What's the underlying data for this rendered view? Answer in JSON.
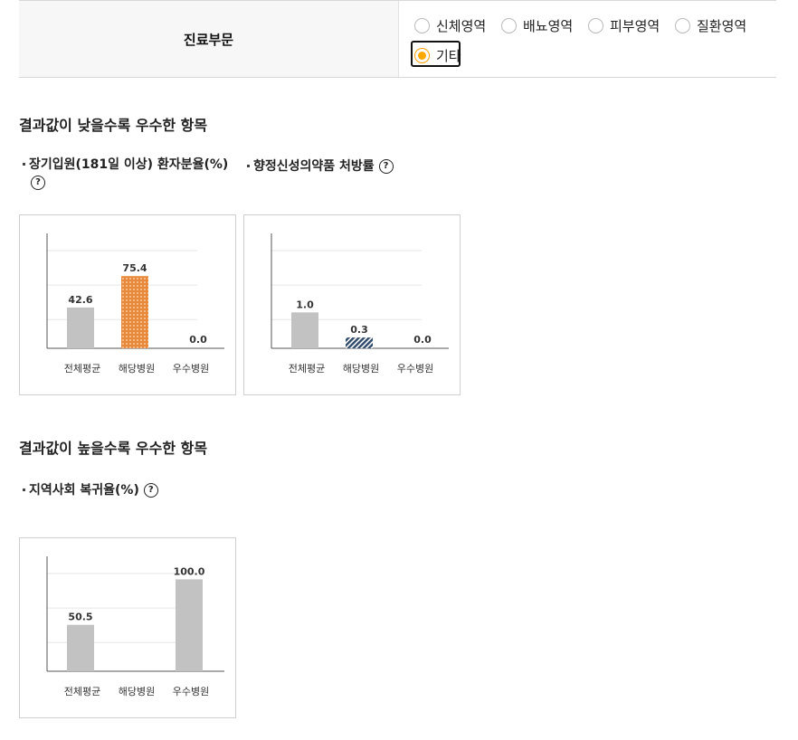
{
  "filter": {
    "label": "진료부문",
    "options": [
      {
        "label": "신체영역",
        "selected": false
      },
      {
        "label": "배뇨영역",
        "selected": false
      },
      {
        "label": "피부영역",
        "selected": false
      },
      {
        "label": "질환영역",
        "selected": false
      },
      {
        "label": "기타",
        "selected": true
      }
    ],
    "accent_color": "#ffa800"
  },
  "sections": [
    {
      "title": "결과값이 낮을수록 우수한 항목"
    },
    {
      "title": "결과값이 높을수록 우수한 항목"
    }
  ],
  "indicators": [
    {
      "name_line1": "장기입원(181일 이상) 환자분율(%)",
      "help_icon": "question-icon"
    },
    {
      "name_line1": "향정신성의약품 처방률",
      "help_icon": "question-icon"
    },
    {
      "name_line1": "지역사회 복귀율(%)",
      "help_icon": "question-icon"
    }
  ],
  "chart_data": [
    {
      "type": "bar",
      "categories": [
        "전체평균",
        "해당병원",
        "우수병원"
      ],
      "values": [
        42.6,
        75.4,
        0.0
      ],
      "data_labels": [
        "42.6",
        "75.4",
        "0.0"
      ],
      "ylim": [
        0,
        120
      ],
      "grid": true,
      "bar_colors": [
        "#c2c2c2",
        "#e8883a",
        "#c2c2c2"
      ],
      "highlight_pattern": "dotted-orange"
    },
    {
      "type": "bar",
      "categories": [
        "전체평균",
        "해당병원",
        "우수병원"
      ],
      "values": [
        1.0,
        0.3,
        0.0
      ],
      "data_labels": [
        "1.0",
        "0.3",
        "0.0"
      ],
      "ylim": [
        0,
        3.2
      ],
      "grid": true,
      "bar_colors": [
        "#c2c2c2",
        "#2f4a6b",
        "#c2c2c2"
      ],
      "highlight_pattern": "striped-navy"
    },
    {
      "type": "bar",
      "categories": [
        "전체평균",
        "해당병원",
        "우수병원"
      ],
      "values": [
        50.5,
        null,
        100.0
      ],
      "data_labels": [
        "50.5",
        "",
        "100.0"
      ],
      "ylim": [
        0,
        125
      ],
      "grid": true,
      "bar_colors": [
        "#c2c2c2",
        "#c2c2c2",
        "#c2c2c2"
      ],
      "highlight_pattern": "none"
    }
  ]
}
